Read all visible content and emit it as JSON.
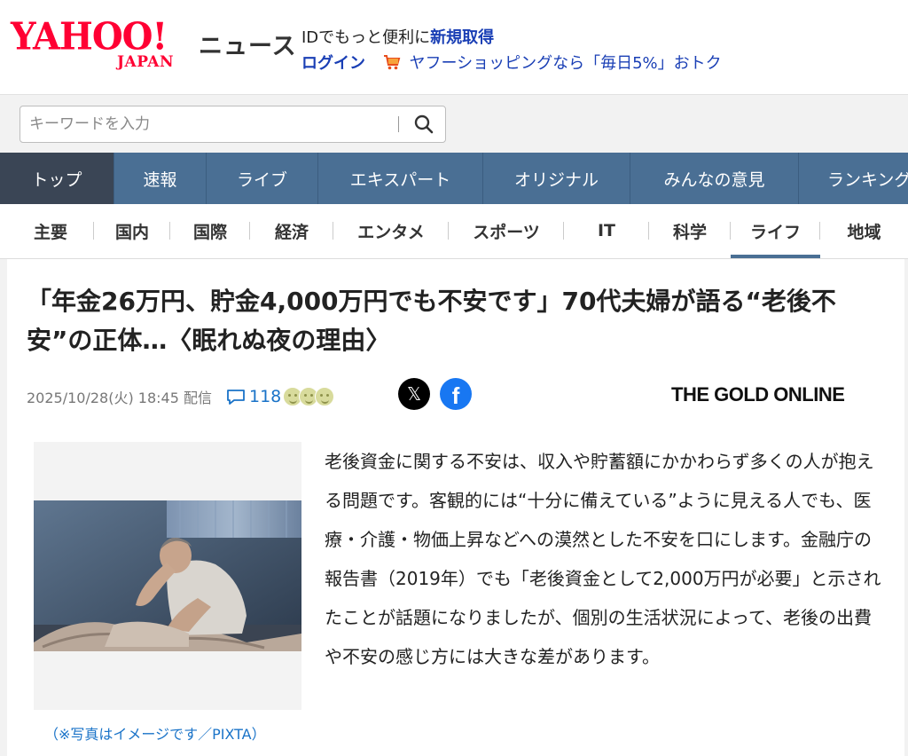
{
  "header": {
    "logo_yahoo": "YAHOO!",
    "logo_japan": "JAPAN",
    "logo_news": "ニュース",
    "promo_text": "IDでもっと便利に",
    "promo_link": "新規取得",
    "login": "ログイン",
    "shopping_text": "ヤフーショッピングなら「毎日5%」おトク",
    "cart_icon": "shopping-cart-icon"
  },
  "search": {
    "placeholder": "キーワードを入力",
    "icon": "search-icon"
  },
  "main_nav": {
    "tabs": [
      {
        "label": "トップ",
        "active": true
      },
      {
        "label": "速報"
      },
      {
        "label": "ライブ"
      },
      {
        "label": "エキスパート"
      },
      {
        "label": "オリジナル"
      },
      {
        "label": "みんなの意見"
      },
      {
        "label": "ランキング"
      }
    ]
  },
  "sub_nav": {
    "items": [
      {
        "label": "主要"
      },
      {
        "label": "国内"
      },
      {
        "label": "国際"
      },
      {
        "label": "経済"
      },
      {
        "label": "エンタメ"
      },
      {
        "label": "スポーツ"
      },
      {
        "label": "IT"
      },
      {
        "label": "科学"
      },
      {
        "label": "ライフ",
        "active": true
      },
      {
        "label": "地域"
      }
    ]
  },
  "article": {
    "title": "「年金26万円、貯金4,000万円でも不安です」70代夫婦が語る“老後不安”の正体…〈眠れぬ夜の理由〉",
    "date": "2025/10/28(火) 18:45 配信",
    "comment_count": "118",
    "share_x_label": "𝕏",
    "share_fb_label": "f",
    "publisher": "THE GOLD ONLINE",
    "caption": "（※写真はイメージです／PIXTA）",
    "body": "老後資金に関する不安は、収入や貯蓄額にかかわらず多くの人が抱える問題です。客観的には“十分に備えている”ように見える人でも、医療・介護・物価上昇などへの漠然とした不安を口にします。金融庁の報告書（2019年）でも「老後資金として2,000万円が必要」と示されたことが話題になりましたが、個別の生活状況によって、老後の出費や不安の感じ方には大きな差があります。"
  },
  "colors": {
    "brand_red": "#ff0033",
    "nav_blue": "#4a6f94",
    "nav_active": "#3a4555",
    "link_blue": "#1a3fb5",
    "facebook_blue": "#1877f2"
  }
}
